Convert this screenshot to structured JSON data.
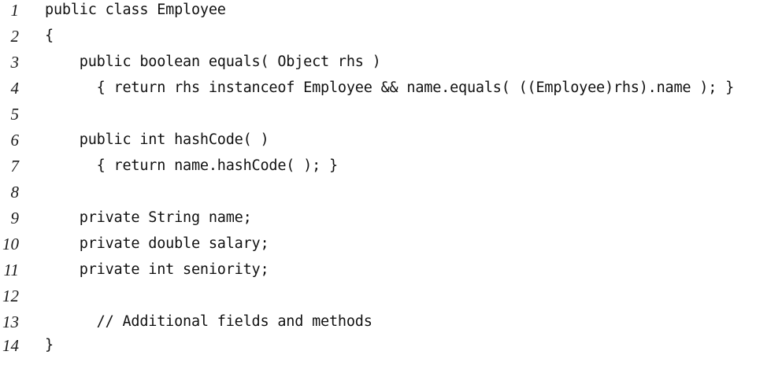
{
  "code_listing": {
    "line_numbers": [
      "1",
      "2",
      "3",
      "4",
      "5",
      "6",
      "7",
      "8",
      "9",
      "10",
      "11",
      "12",
      "13",
      "14"
    ],
    "lines": [
      "public class Employee",
      "{",
      "    public boolean equals( Object rhs )",
      "      { return rhs instanceof Employee && name.equals( ((Employee)rhs).name ); }",
      "",
      "    public int hashCode( )",
      "      { return name.hashCode( ); }",
      "",
      "    private String name;",
      "    private double salary;",
      "    private int seniority;",
      "",
      "      // Additional fields and methods",
      "}"
    ]
  }
}
